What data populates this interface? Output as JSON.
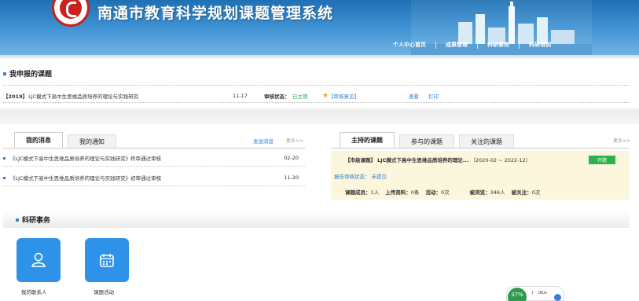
{
  "header": {
    "site_title": "南通市教育科学规划课题管理系统",
    "nav": [
      "个人中心首页",
      "成果管理",
      "科研事务",
      "科研培训"
    ]
  },
  "section_my_topics": {
    "title": "我申报的课题",
    "row": {
      "year": "【2019】",
      "title": "LJC模式下高中生思维品质培养的理论与实践研究",
      "date": "11-17",
      "status_label": "审核状态：",
      "status_value": "已立项",
      "opinion": "【审核意见】",
      "view": "查看",
      "print": "打印"
    }
  },
  "messages_panel": {
    "tabs": [
      "我的消息",
      "我的通知"
    ],
    "send_link": "发送消息",
    "more": "更多>>",
    "items": [
      {
        "text": "《LJC模式下高中生思维品质培养的理论与实践研究》终审通过审核",
        "date": "02-20"
      },
      {
        "text": "《LJC模式下高中生思维品质培养的理论与实践研究》初审通过审核",
        "date": "11-20"
      }
    ]
  },
  "topics_panel": {
    "tabs": [
      "主持的课题",
      "参与的课题",
      "关注的课题"
    ],
    "more": "更多>>",
    "topic": {
      "level": "【市级课题】",
      "title": "LJC模式下高中生思维品质培养的理论...",
      "period": "（2020-02 ~ 2022-12）",
      "badge": "开题",
      "report_status_label": "报告审核状态：",
      "report_status_value": "未提交",
      "stats": [
        {
          "label": "课题成员：",
          "value": "1人"
        },
        {
          "label": "上传资料：",
          "value": "0条"
        },
        {
          "label": "活动：",
          "value": "0次"
        },
        {
          "label": "被浏览：",
          "value": "346人"
        },
        {
          "label": "被关注：",
          "value": "0次"
        }
      ]
    }
  },
  "section_research": {
    "title": "科研事务",
    "tiles": [
      {
        "label": "我的联系人",
        "icon": "contacts-icon"
      },
      {
        "label": "课题活动",
        "icon": "calendar-icon"
      }
    ]
  },
  "speed_widget": {
    "percent": "37%",
    "rate": "0K/s"
  },
  "colors": {
    "accent": "#2a7fd4",
    "status_green": "#1aa33a",
    "badge_green": "#2bb24c",
    "tile_blue": "#2e93e8"
  }
}
